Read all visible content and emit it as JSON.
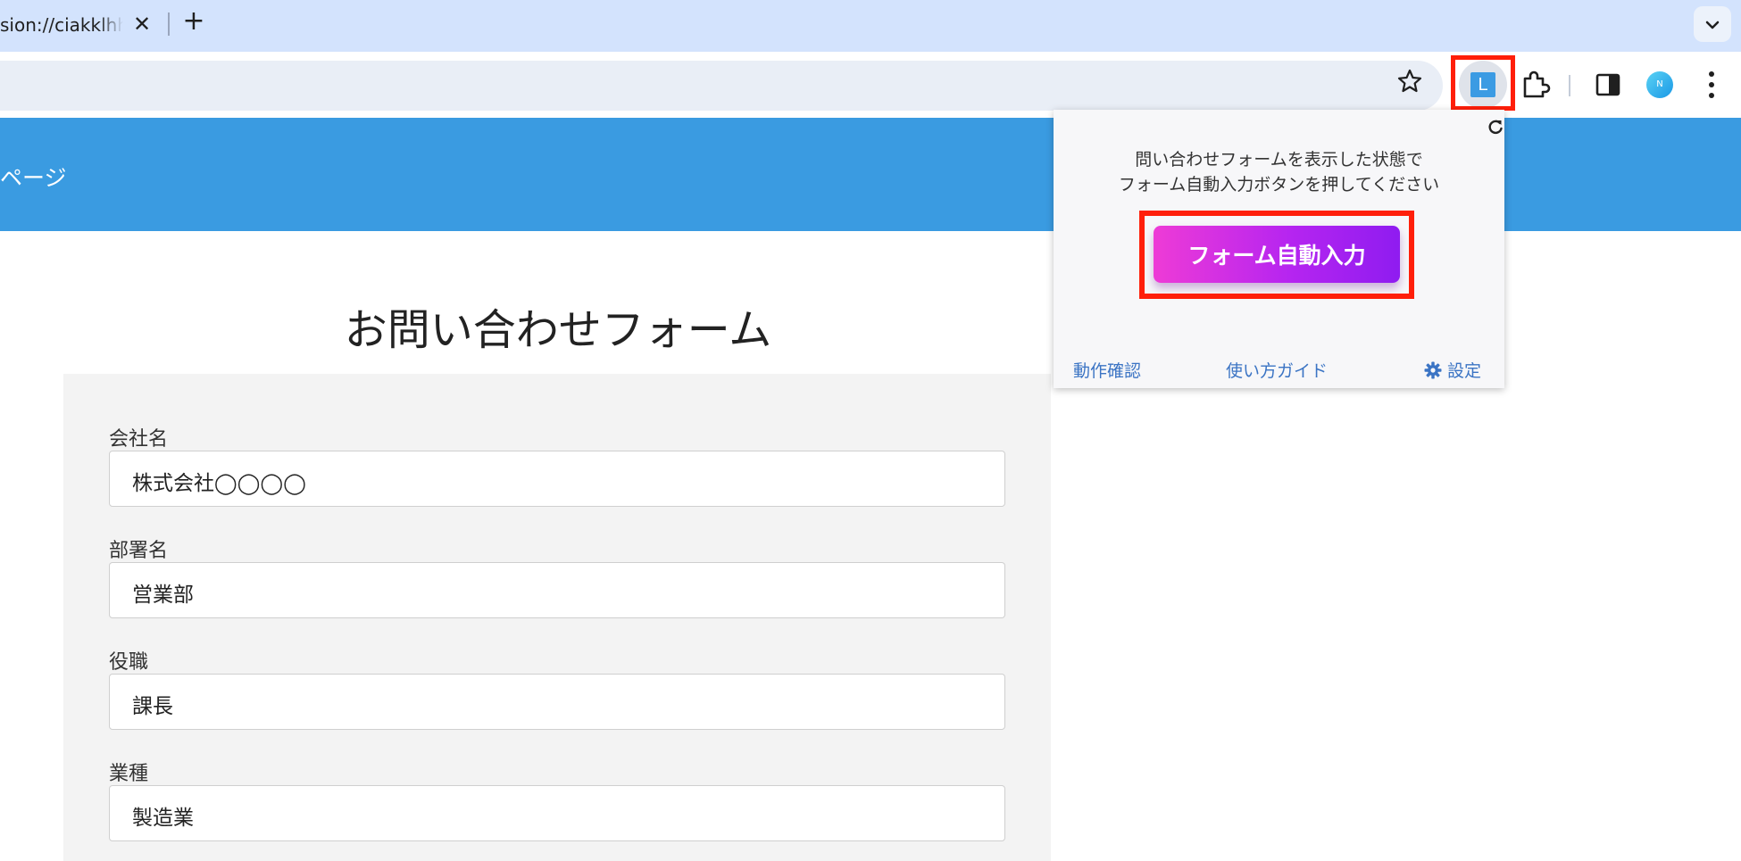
{
  "browser": {
    "tab": {
      "title": "sion://ciakklhhlc",
      "close_label": "✕"
    },
    "new_tab_label": "+",
    "avatar_initial": "N",
    "extension_badge": "L"
  },
  "page": {
    "header_title": "ページ",
    "form_title": "お問い合わせフォーム",
    "fields": [
      {
        "label": "会社名",
        "value": "株式会社◯◯◯◯"
      },
      {
        "label": "部署名",
        "value": "営業部"
      },
      {
        "label": "役職",
        "value": "課長"
      },
      {
        "label": "業種",
        "value": "製造業"
      }
    ]
  },
  "popup": {
    "message_line1": "問い合わせフォームを表示した状態で",
    "message_line2": "フォーム自動入力ボタンを押してください",
    "autofill_button": "フォーム自動入力",
    "links": {
      "check": "動作確認",
      "guide": "使い方ガイド",
      "settings": "設定"
    }
  },
  "colors": {
    "header_blue": "#3a9be1",
    "highlight_red": "#ff1f0a",
    "button_gradient_start": "#ee3bd6",
    "button_gradient_end": "#8f1cf0",
    "link_blue": "#3b74c4"
  }
}
